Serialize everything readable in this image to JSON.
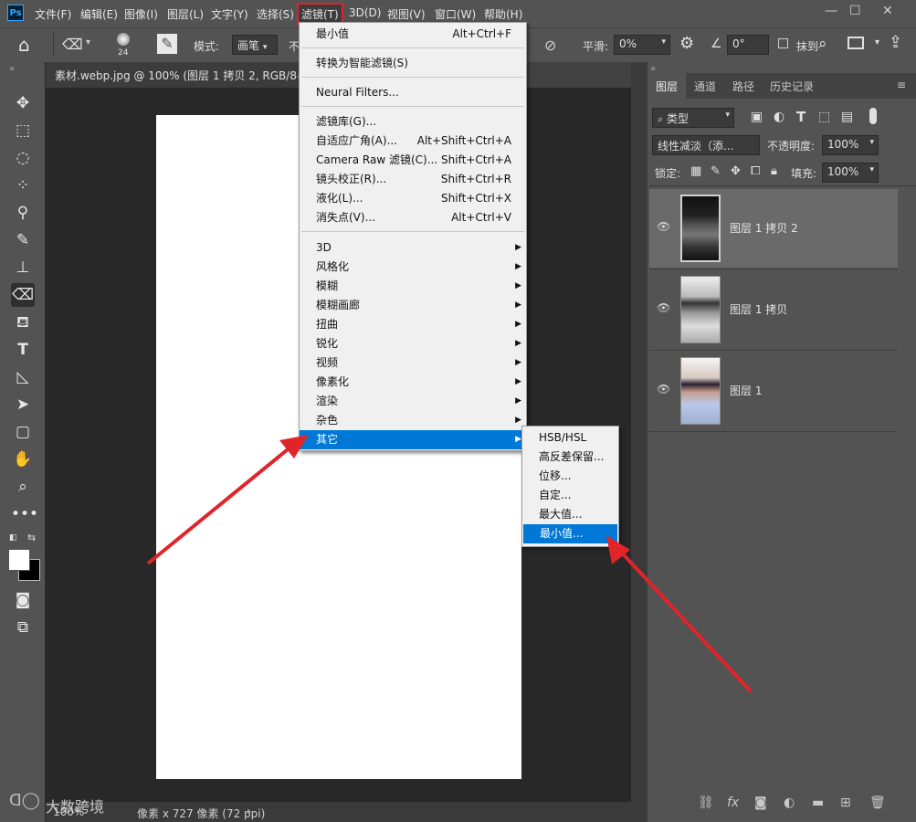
{
  "menubar": {
    "logo": "Ps",
    "items": [
      "文件(F)",
      "编辑(E)",
      "图像(I)",
      "图层(L)",
      "文字(Y)",
      "选择(S)",
      "滤镜(T)",
      "3D(D)",
      "视图(V)",
      "窗口(W)",
      "帮助(H)"
    ],
    "active_item": "滤镜(T)"
  },
  "options_bar": {
    "brush_size": "24",
    "mode_label": "模式:",
    "mode_value": "画笔",
    "opacity_label": "不",
    "smoothing_label": "平滑:",
    "smoothing_value": "0%",
    "angle_value": "0°",
    "erase_history_label": "抹到"
  },
  "document": {
    "tab_title": "素材.webp.jpg @ 100% (图层 1 拷贝 2, RGB/8#"
  },
  "status_bar": {
    "zoom": "100%",
    "doc_info": "像素 x 727 像素 (72 ppi)",
    "watermark": "大数跨境"
  },
  "filter_menu": {
    "top_items": [
      {
        "label": "最小值",
        "shortcut": "Alt+Ctrl+F"
      }
    ],
    "smart": "转换为智能滤镜(S)",
    "neural": "Neural Filters...",
    "group1": [
      {
        "label": "滤镜库(G)...",
        "shortcut": ""
      },
      {
        "label": "自适应广角(A)...",
        "shortcut": "Alt+Shift+Ctrl+A"
      },
      {
        "label": "Camera Raw 滤镜(C)...",
        "shortcut": "Shift+Ctrl+A"
      },
      {
        "label": "镜头校正(R)...",
        "shortcut": "Shift+Ctrl+R"
      },
      {
        "label": "液化(L)...",
        "shortcut": "Shift+Ctrl+X"
      },
      {
        "label": "消失点(V)...",
        "shortcut": "Alt+Ctrl+V"
      }
    ],
    "submenus": [
      "3D",
      "风格化",
      "模糊",
      "模糊画廊",
      "扭曲",
      "锐化",
      "视频",
      "像素化",
      "渲染",
      "杂色",
      "其它"
    ],
    "highlighted": "其它"
  },
  "other_submenu": {
    "items": [
      "HSB/HSL",
      "高反差保留...",
      "位移...",
      "自定...",
      "最大值...",
      "最小值..."
    ],
    "highlighted": "最小值..."
  },
  "layers_panel": {
    "tabs": [
      "图层",
      "通道",
      "路径",
      "历史记录"
    ],
    "filter_kind": "类型",
    "blend_mode": "线性减淡（添...",
    "opacity_label": "不透明度:",
    "opacity_value": "100%",
    "lock_label": "锁定:",
    "fill_label": "填充:",
    "fill_value": "100%",
    "layers": [
      {
        "name": "图层 1 拷贝 2",
        "selected": true
      },
      {
        "name": "图层 1 拷贝",
        "selected": false
      },
      {
        "name": "图层 1",
        "selected": false
      }
    ]
  },
  "colors": {
    "highlight": "#0078d7",
    "annotation_arrow": "#e0242a"
  }
}
